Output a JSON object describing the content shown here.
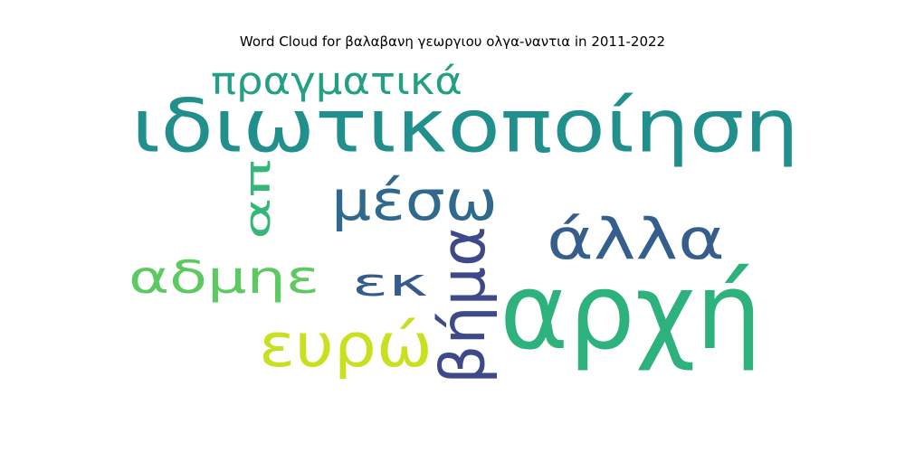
{
  "chart_data": {
    "type": "wordcloud",
    "title": "Word Cloud for βαλαβανη γεωργιου ολγα-ναντια in 2011-2022",
    "words": [
      {
        "text": "ιδιωτικοποίηση",
        "color": "#21908d"
      },
      {
        "text": "αρχή",
        "color": "#2db27d"
      },
      {
        "text": "άλλα",
        "color": "#355e8d"
      },
      {
        "text": "βήμα",
        "color": "#3e4989"
      },
      {
        "text": "μέσω",
        "color": "#30698e"
      },
      {
        "text": "απ",
        "color": "#35b779"
      },
      {
        "text": "αδμηε",
        "color": "#5ec962"
      },
      {
        "text": "εκ",
        "color": "#365c8d"
      },
      {
        "text": "ευρώ",
        "color": "#c8e020"
      },
      {
        "text": "πραγματικά",
        "color": "#23a083"
      }
    ]
  }
}
